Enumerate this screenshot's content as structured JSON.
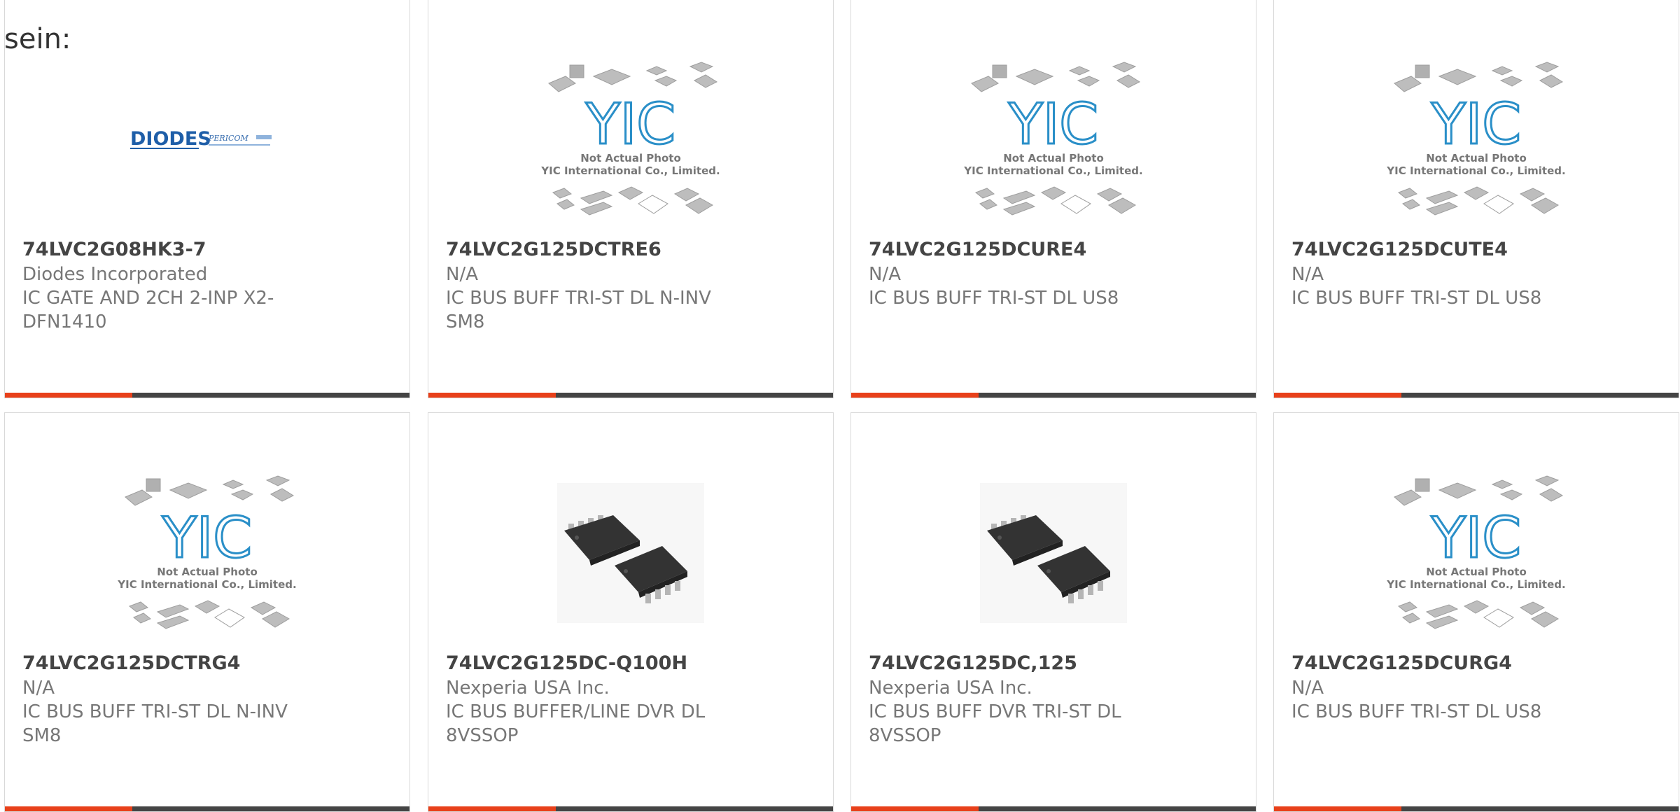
{
  "page": {
    "prefix_text": "sein:"
  },
  "colors": {
    "accent": "#e8401a",
    "bar_dark": "#444444",
    "part_number": "#444444",
    "secondary_text": "#777777",
    "border": "#d9d9d9"
  },
  "placeholder": {
    "line1": "Not Actual Photo",
    "line2": "YIC International Co., Limited.",
    "logo_letters": "YIC"
  },
  "diodes_logo": {
    "brand": "DIODES",
    "sub": "PERICOM"
  },
  "products": [
    {
      "part_number": "74LVC2G08HK3-7",
      "manufacturer": "Diodes Incorporated",
      "description": "IC GATE AND 2CH 2-INP X2-DFN1410",
      "image": "diodes-pericom-logo"
    },
    {
      "part_number": "74LVC2G125DCTRE6",
      "manufacturer": "N/A",
      "description": "IC BUS BUFF TRI-ST DL N-INV SM8",
      "image": "yic-placeholder"
    },
    {
      "part_number": "74LVC2G125DCURE4",
      "manufacturer": "N/A",
      "description": "IC BUS BUFF TRI-ST DL US8",
      "image": "yic-placeholder"
    },
    {
      "part_number": "74LVC2G125DCUTE4",
      "manufacturer": "N/A",
      "description": "IC BUS BUFF TRI-ST DL US8",
      "image": "yic-placeholder"
    },
    {
      "part_number": "74LVC2G125DCTRG4",
      "manufacturer": "N/A",
      "description": "IC BUS BUFF TRI-ST DL N-INV SM8",
      "image": "yic-placeholder"
    },
    {
      "part_number": "74LVC2G125DC-Q100H",
      "manufacturer": "Nexperia USA Inc.",
      "description": "IC BUS BUFFER/LINE DVR DL 8VSSOP",
      "image": "vssop-chip-photo"
    },
    {
      "part_number": "74LVC2G125DC,125",
      "manufacturer": "Nexperia USA Inc.",
      "description": "IC BUS BUFF DVR TRI-ST DL 8VSSOP",
      "image": "vssop-chip-photo"
    },
    {
      "part_number": "74LVC2G125DCURG4",
      "manufacturer": "N/A",
      "description": "IC BUS BUFF TRI-ST DL US8",
      "image": "yic-placeholder"
    }
  ]
}
